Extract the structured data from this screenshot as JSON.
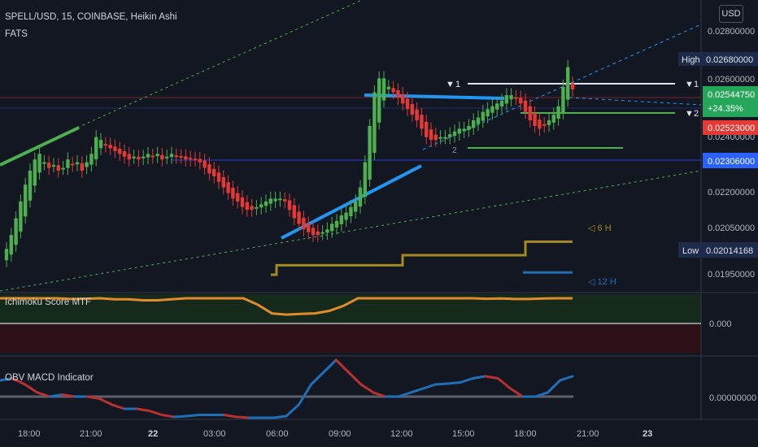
{
  "header": {
    "symbol_line": "SPELL/USD, 15, COINBASE, Heikin Ashi",
    "indicator": "FATS"
  },
  "currency_button": "USD",
  "panes": {
    "ichimoku_label": "Ichimoku Score MTF",
    "ichimoku_value": "0.000",
    "macd_label": "OBV MACD Indicator",
    "macd_value": "0.00000000"
  },
  "price_axis": {
    "ticks": [
      "0.02800000",
      "0.02600000",
      "0.02200000",
      "0.02050000",
      "0.01950000"
    ],
    "hidden_tick": "0.02400000",
    "high_label": "High",
    "high_value": "0.02680000",
    "low_label": "Low",
    "low_value": "0.02014168",
    "last_price": "0.02544750",
    "change_pct": "+24.35%",
    "red_level": "0.02523000",
    "blue_level": "0.02306000"
  },
  "time_axis": [
    "18:00",
    "21:00",
    "22",
    "03:00",
    "06:00",
    "09:00",
    "12:00",
    "15:00",
    "18:00",
    "21:00",
    "23"
  ],
  "annotations": {
    "level_1_left": "1",
    "level_1_right": "1",
    "level_2_right": "2",
    "level_2_mid": "2",
    "mtf_6h": "6 H",
    "mtf_12h": "12 H"
  },
  "colors": {
    "background": "#131722",
    "bull": "#4caf50",
    "bear": "#e53935",
    "trendline_blue": "#2196f3",
    "gold": "#a38a23",
    "orange": "#e08c2a",
    "obv_blue": "#1e6fb5",
    "obv_red": "#b8302f"
  },
  "chart_data": {
    "type": "candlestick",
    "style": "Heikin Ashi",
    "symbol": "SPELL/USD",
    "interval": "15",
    "exchange": "COINBASE",
    "y_range": [
      0.0186,
      0.029
    ],
    "high": 0.0268,
    "low": 0.02014168,
    "last": 0.0254475,
    "change_pct": 24.35,
    "levels": [
      0.02523,
      0.02306
    ],
    "closes": [
      0.0201,
      0.0206,
      0.0212,
      0.0218,
      0.0224,
      0.0229,
      0.0233,
      0.0235,
      0.0232,
      0.023,
      0.0231,
      0.0229,
      0.023,
      0.0233,
      0.0231,
      0.0232,
      0.0229,
      0.0232,
      0.0235,
      0.0241,
      0.024,
      0.0238,
      0.0237,
      0.0236,
      0.0235,
      0.0234,
      0.0233,
      0.0234,
      0.0233,
      0.0234,
      0.0235,
      0.0234,
      0.0235,
      0.0233,
      0.0234,
      0.0235,
      0.0234,
      0.0234,
      0.0233,
      0.0233,
      0.0233,
      0.0232,
      0.023,
      0.0228,
      0.0227,
      0.0225,
      0.0223,
      0.0221,
      0.0219,
      0.0218,
      0.0216,
      0.0215,
      0.0215,
      0.0216,
      0.0217,
      0.0218,
      0.0219,
      0.0219,
      0.0219,
      0.0218,
      0.0215,
      0.0212,
      0.021,
      0.0208,
      0.0207,
      0.0206,
      0.0206,
      0.0207,
      0.0208,
      0.021,
      0.0211,
      0.0213,
      0.0214,
      0.0216,
      0.0218,
      0.0223,
      0.0232,
      0.0245,
      0.0257,
      0.0262,
      0.0262,
      0.0259,
      0.0257,
      0.0255,
      0.0253,
      0.0251,
      0.0249,
      0.0247,
      0.0244,
      0.0241,
      0.024,
      0.024,
      0.0241,
      0.0241,
      0.0242,
      0.0243,
      0.0244,
      0.0244,
      0.0245,
      0.0247,
      0.0248,
      0.025,
      0.0251,
      0.0252,
      0.0253,
      0.0254,
      0.0256,
      0.0256,
      0.0255,
      0.0253,
      0.025,
      0.0247,
      0.0245,
      0.0244,
      0.0245,
      0.0247,
      0.0249,
      0.0252,
      0.0259,
      0.0266,
      0.0258
    ],
    "mtf_6h_line": [
      0.01918,
      0.01918,
      0.01952,
      0.01952,
      0.01952,
      0.01952,
      0.01988,
      0.01988,
      0.01988,
      0.02036,
      0.02036
    ],
    "mtf_12h_line": [
      0.01926,
      0.01926
    ],
    "ichimoku_score": [
      1,
      1,
      1,
      1,
      1,
      0.97,
      0.98,
      1,
      0.96,
      0.96,
      0.92,
      0.92,
      0.96,
      1,
      1,
      1,
      1,
      1,
      0.75,
      0.4,
      0.35,
      0.38,
      0.4,
      0.5,
      0.7,
      1,
      1,
      1,
      1,
      1,
      1,
      1,
      1,
      1,
      0.98,
      0.99,
      0.97,
      0.97,
      0.99,
      1,
      1
    ],
    "obv_macd": [
      0.4,
      0.45,
      0.3,
      0.1,
      0.0,
      0.05,
      0.0,
      0.0,
      -0.05,
      -0.2,
      -0.3,
      -0.3,
      -0.35,
      -0.45,
      -0.5,
      -0.48,
      -0.45,
      -0.45,
      -0.45,
      -0.5,
      -0.52,
      -0.52,
      -0.52,
      -0.48,
      -0.2,
      0.3,
      0.6,
      0.9,
      0.6,
      0.3,
      0.1,
      0.0,
      0.0,
      0.1,
      0.2,
      0.3,
      0.32,
      0.35,
      0.45,
      0.5,
      0.45,
      0.2,
      0.0,
      0.0,
      0.1,
      0.4,
      0.5
    ]
  }
}
